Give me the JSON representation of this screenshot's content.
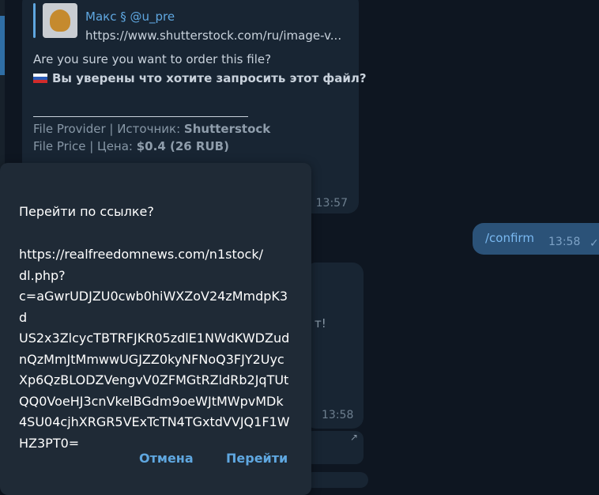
{
  "chat": {
    "message1": {
      "quote_name": "Макс § @u_pre",
      "quote_url": "https://www.shutterstock.com/ru/image-v...",
      "question_en": "Are you sure you want to order this file?",
      "question_ru": "Вы уверены что хотите запросить этот файл?",
      "provider_label": "File Provider | Источник: ",
      "provider_value": "Shutterstock",
      "price_label": "File Price | Цена: ",
      "price_value": "$0.4 (26 RUB)",
      "time": "13:57"
    },
    "outgoing": {
      "text": "/confirm",
      "time": "13:58",
      "status_icon": "double-check-icon"
    },
    "message2": {
      "fragment": "т!",
      "time": "13:58"
    }
  },
  "dialog": {
    "title": "Перейти по ссылке?",
    "url_lines": [
      "https://realfreedomnews.com/n1stock/",
      "dl.php?",
      "c=aGwrUDJZU0cwb0hiWXZoV24zMmdpK3d",
      "US2x3ZlcycTBTRFJKR05zdlE1NWdKWDZud",
      "nQzMmJtMmwwUGJZZ0kyNFNoQ3FJY2Uyc",
      "Xp6QzBLODZVengvV0ZFMGtRZldRb2JqTUt",
      "QQ0VoeHJ3cnVkelBGdm9oeWJtMWpvMDk",
      "4SU04cjhXRGR5VExTcTN4TGxtdVVJQ1F1W",
      "HZ3PT0="
    ],
    "cancel_label": "Отмена",
    "confirm_label": "Перейти"
  },
  "colors": {
    "background": "#0e1621",
    "bubble_incoming": "#182533",
    "bubble_outgoing": "#2b5278",
    "dialog": "#1f2a36",
    "accent": "#5fa7e0"
  }
}
